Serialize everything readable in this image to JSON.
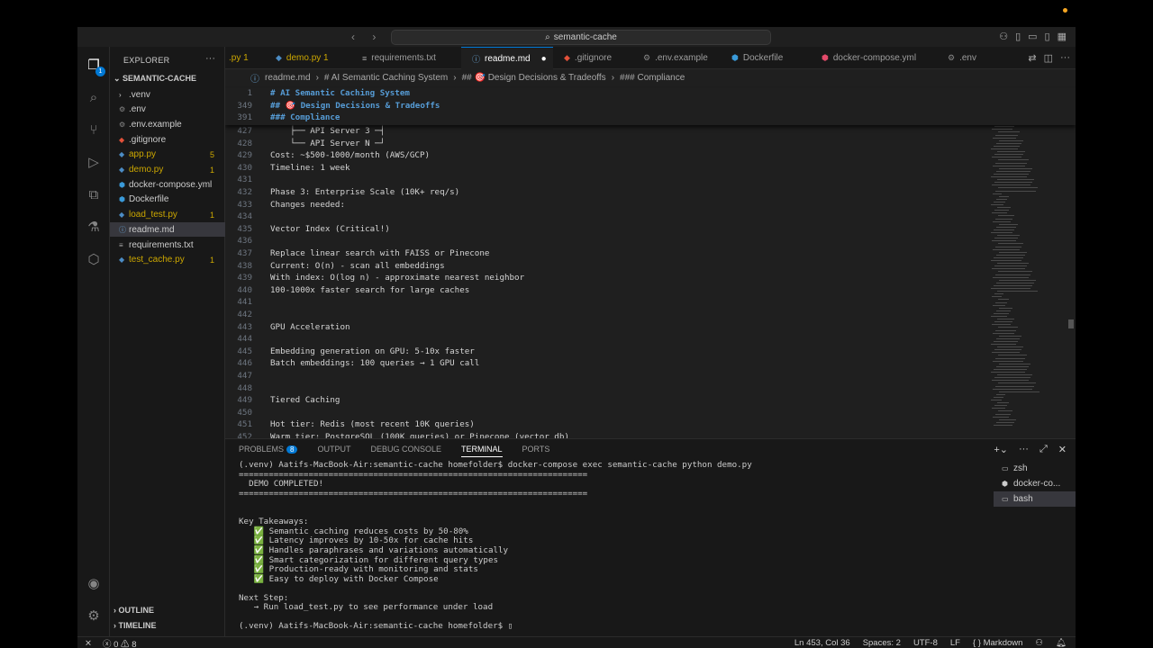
{
  "titlebar": {
    "search_text": "semantic-cache"
  },
  "activity": {
    "explorer_badge": "1"
  },
  "explorer": {
    "title": "EXPLORER",
    "root": "SEMANTIC-CACHE",
    "files": [
      {
        "name": ".venv",
        "icon": "chevron-right",
        "color": "#cccccc",
        "badge": ""
      },
      {
        "name": ".env",
        "icon": "gear",
        "color": "#cccccc",
        "badge": ""
      },
      {
        "name": ".env.example",
        "icon": "gear",
        "color": "#cccccc",
        "badge": ""
      },
      {
        "name": ".gitignore",
        "icon": "git",
        "color": "#cccccc",
        "badge": ""
      },
      {
        "name": "app.py",
        "icon": "python",
        "color": "#cca700",
        "badge": "5"
      },
      {
        "name": "demo.py",
        "icon": "python",
        "color": "#cca700",
        "badge": "1"
      },
      {
        "name": "docker-compose.yml",
        "icon": "docker",
        "color": "#cccccc",
        "badge": ""
      },
      {
        "name": "Dockerfile",
        "icon": "docker",
        "color": "#cccccc",
        "badge": ""
      },
      {
        "name": "load_test.py",
        "icon": "python",
        "color": "#cca700",
        "badge": "1"
      },
      {
        "name": "readme.md",
        "icon": "info",
        "color": "#cccccc",
        "badge": ""
      },
      {
        "name": "requirements.txt",
        "icon": "list",
        "color": "#cccccc",
        "badge": ""
      },
      {
        "name": "test_cache.py",
        "icon": "python",
        "color": "#cca700",
        "badge": "1"
      }
    ],
    "outline": "OUTLINE",
    "timeline": "TIMELINE"
  },
  "tabs": [
    {
      "label": ".py 1",
      "color": "#cca700"
    },
    {
      "label": "demo.py 1",
      "color": "#cca700"
    },
    {
      "label": "requirements.txt",
      "color": "#9d9d9d"
    },
    {
      "label": "readme.md",
      "color": "#ffffff",
      "modified": "●"
    },
    {
      "label": ".gitignore",
      "color": "#9d9d9d"
    },
    {
      "label": ".env.example",
      "color": "#9d9d9d"
    },
    {
      "label": "Dockerfile",
      "color": "#9d9d9d"
    },
    {
      "label": "docker-compose.yml",
      "color": "#9d9d9d"
    },
    {
      "label": ".env",
      "color": "#9d9d9d"
    }
  ],
  "breadcrumb": [
    "readme.md",
    "# AI Semantic Caching System",
    "## 🎯 Design Decisions & Tradeoffs",
    "### Compliance"
  ],
  "sticky_lines": [
    {
      "n": "1",
      "text": "# AI Semantic Caching System"
    },
    {
      "n": "349",
      "text": "## 🎯 Design Decisions & Tradeoffs"
    },
    {
      "n": "391",
      "text": "### Compliance"
    }
  ],
  "lines": [
    {
      "n": "427",
      "text": "    ├── API Server 3 ─┤"
    },
    {
      "n": "428",
      "text": "    └── API Server N ─┘"
    },
    {
      "n": "429",
      "text": "Cost: ~$500-1000/month (AWS/GCP)"
    },
    {
      "n": "430",
      "text": "Timeline: 1 week"
    },
    {
      "n": "431",
      "text": ""
    },
    {
      "n": "432",
      "text": "Phase 3: Enterprise Scale (10K+ req/s)"
    },
    {
      "n": "433",
      "text": "Changes needed:"
    },
    {
      "n": "434",
      "text": ""
    },
    {
      "n": "435",
      "text": "Vector Index (Critical!)"
    },
    {
      "n": "436",
      "text": ""
    },
    {
      "n": "437",
      "text": "Replace linear search with FAISS or Pinecone"
    },
    {
      "n": "438",
      "text": "Current: O(n) - scan all embeddings"
    },
    {
      "n": "439",
      "text": "With index: O(log n) - approximate nearest neighbor"
    },
    {
      "n": "440",
      "text": "100-1000x faster search for large caches"
    },
    {
      "n": "441",
      "text": ""
    },
    {
      "n": "442",
      "text": ""
    },
    {
      "n": "443",
      "text": "GPU Acceleration"
    },
    {
      "n": "444",
      "text": ""
    },
    {
      "n": "445",
      "text": "Embedding generation on GPU: 5-10x faster"
    },
    {
      "n": "446",
      "text": "Batch embeddings: 100 queries → 1 GPU call"
    },
    {
      "n": "447",
      "text": ""
    },
    {
      "n": "448",
      "text": ""
    },
    {
      "n": "449",
      "text": "Tiered Caching"
    },
    {
      "n": "450",
      "text": ""
    },
    {
      "n": "451",
      "text": "Hot tier: Redis (most recent 10K queries)"
    },
    {
      "n": "452",
      "text": "Warm tier: PostgreSQL (100K queries) or Pinecone (vector db)"
    }
  ],
  "panel": {
    "tabs": [
      "PROBLEMS",
      "OUTPUT",
      "DEBUG CONSOLE",
      "TERMINAL",
      "PORTS"
    ],
    "problems_count": "8",
    "terminal_lines": [
      "(.venv) Aatifs-MacBook-Air:semantic-cache homefolder$ docker-compose exec semantic-cache python demo.py",
      "======================================================================",
      "  DEMO COMPLETED!",
      "======================================================================",
      "",
      "",
      "Key Takeaways:",
      "   ✅ Semantic caching reduces costs by 50-80%",
      "   ✅ Latency improves by 10-50x for cache hits",
      "   ✅ Handles paraphrases and variations automatically",
      "   ✅ Smart categorization for different query types",
      "   ✅ Production-ready with monitoring and stats",
      "   ✅ Easy to deploy with Docker Compose",
      "",
      "Next Step:",
      "   → Run load_test.py to see performance under load",
      "",
      "(.venv) Aatifs-MacBook-Air:semantic-cache homefolder$ ▯"
    ],
    "terminals": [
      "zsh",
      "docker-co...",
      "bash"
    ]
  },
  "status": {
    "errors": "0",
    "warnings": "8",
    "position": "Ln 453, Col 36",
    "spaces": "Spaces: 2",
    "encoding": "UTF-8",
    "eol": "LF",
    "language": "Markdown"
  }
}
